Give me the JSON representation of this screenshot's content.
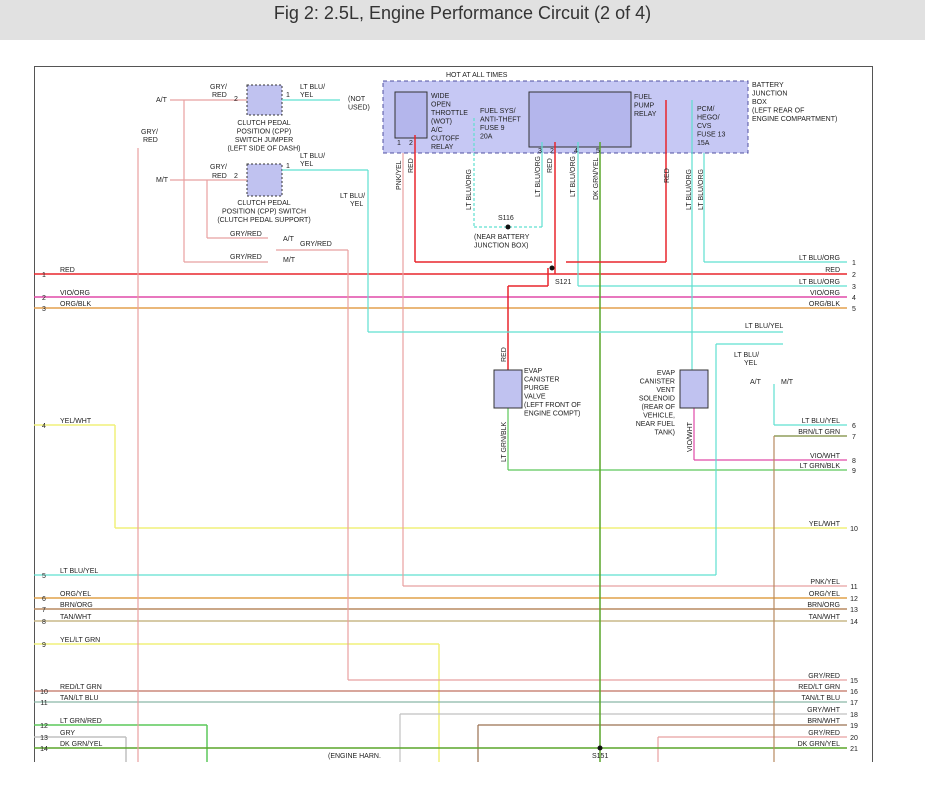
{
  "header": {
    "title": "Fig 2: 2.5L, Engine Performance Circuit (2 of 4)"
  },
  "colors": {
    "red": "#e8262d",
    "violet_orange": "#e04aa8",
    "orange_black": "#e3a04f",
    "lt_blue": "#5fe0d0",
    "yellow": "#f0f07a",
    "orange_yellow": "#e0a24a",
    "brown": "#b88a60",
    "tan": "#c9b889",
    "green": "#5cc85a",
    "gray": "#c0c0c0",
    "pink": "#e8a0a0",
    "dk_green": "#5aa62a",
    "component_fill": "#c0c2f0",
    "component_border": "#5050a0",
    "junction_box_fill": "#c6c8f4"
  },
  "diagram": {
    "hot_at_all_times": "HOT AT ALL TIMES",
    "battery_junction_box": [
      "BATTERY",
      "JUNCTION",
      "BOX",
      "(LEFT REAR OF",
      "ENGINE COMPARTMENT)"
    ],
    "wot_relay": [
      "WIDE",
      "OPEN",
      "THROTTLE",
      "(WOT)",
      "A/C",
      "CUTOFF",
      "RELAY"
    ],
    "fuse9": [
      "FUEL SYS/",
      "ANTI-THEFT",
      "FUSE 9",
      "20A"
    ],
    "fuel_pump_relay": [
      "FUEL",
      "PUMP",
      "RELAY"
    ],
    "fuse13": [
      "PCM/",
      "HEGO/",
      "CVS",
      "FUSE 13",
      "15A"
    ],
    "cpp_jumper": [
      "CLUTCH PEDAL",
      "POSITION (CPP)",
      "SWITCH JUMPER",
      "(LEFT SIDE OF DASH)"
    ],
    "cpp_switch": [
      "CLUTCH PEDAL",
      "POSITION (CPP) SWITCH",
      "(CLUTCH PEDAL SUPPORT)"
    ],
    "not_used": [
      "(NOT",
      "USED)"
    ],
    "evap_purge": [
      "EVAP",
      "CANISTER",
      "PURGE",
      "VALVE",
      "(LEFT FRONT OF",
      "ENGINE COMPT)"
    ],
    "evap_vent": [
      "EVAP",
      "CANISTER",
      "VENT",
      "SOLENOID",
      "(REAR OF",
      "VEHICLE,",
      "NEAR FUEL",
      "TANK)"
    ],
    "s116": "S116",
    "s116_note": [
      "(NEAR BATTERY",
      "JUNCTION BOX)"
    ],
    "s121": "S121",
    "s151": "S151",
    "engine_harn": "(ENGINE HARN.",
    "at": "A/T",
    "mt": "M/T",
    "top_labels": {
      "gry_red": [
        "GRY/",
        "RED"
      ],
      "lt_blu_yel": [
        "LT BLU/",
        "YEL"
      ],
      "pin2": "2",
      "pin1": "1",
      "pin3": "3",
      "pin4": "4",
      "pin5": "5",
      "pin6": "6"
    },
    "vertical_labels": [
      "PNK/YEL",
      "RED",
      "LT BLU/ORG",
      "LT BLU/ORG",
      "RED",
      "LT BLU/ORG",
      "DK GRN/YEL",
      "RED",
      "LT BLU/ORG",
      "LT BLU/ORG",
      "RED",
      "LT GRN/BLK",
      "VIO/WHT"
    ],
    "misc_labels": {
      "gry_red_at": "GRY/RED",
      "gry_red_mt": "GRY/RED",
      "gry_red_mid": "GRY/RED",
      "lt_blu_yel_mid": "LT BLU/YEL",
      "lt_blu_yel_right": [
        "LT BLU/",
        "YEL"
      ],
      "gry_red_left": [
        "GRY/",
        "RED"
      ]
    },
    "left_wires": [
      {
        "num": "1",
        "label": "RED"
      },
      {
        "num": "2",
        "label": "VIO/ORG"
      },
      {
        "num": "3",
        "label": "ORG/BLK"
      },
      {
        "num": "4",
        "label": "YEL/WHT"
      },
      {
        "num": "5",
        "label": "LT BLU/YEL"
      },
      {
        "num": "6",
        "label": "ORG/YEL"
      },
      {
        "num": "7",
        "label": "BRN/ORG"
      },
      {
        "num": "8",
        "label": "TAN/WHT"
      },
      {
        "num": "9",
        "label": "YEL/LT GRN"
      },
      {
        "num": "10",
        "label": "RED/LT GRN"
      },
      {
        "num": "11",
        "label": "TAN/LT BLU"
      },
      {
        "num": "12",
        "label": "LT GRN/RED"
      },
      {
        "num": "13",
        "label": "GRY"
      },
      {
        "num": "14",
        "label": "DK GRN/YEL"
      }
    ],
    "right_wires": [
      {
        "num": "1",
        "label": "LT BLU/ORG"
      },
      {
        "num": "2",
        "label": "RED"
      },
      {
        "num": "3",
        "label": "LT BLU/ORG"
      },
      {
        "num": "4",
        "label": "VIO/ORG"
      },
      {
        "num": "5",
        "label": "ORG/BLK"
      },
      {
        "num": "6",
        "label": "LT BLU/YEL"
      },
      {
        "num": "7",
        "label": "BRN/LT GRN"
      },
      {
        "num": "8",
        "label": "VIO/WHT"
      },
      {
        "num": "9",
        "label": "LT GRN/BLK"
      },
      {
        "num": "10",
        "label": "YEL/WHT"
      },
      {
        "num": "11",
        "label": "PNK/YEL"
      },
      {
        "num": "12",
        "label": "ORG/YEL"
      },
      {
        "num": "13",
        "label": "BRN/ORG"
      },
      {
        "num": "14",
        "label": "TAN/WHT"
      },
      {
        "num": "15",
        "label": "GRY/RED"
      },
      {
        "num": "16",
        "label": "RED/LT GRN"
      },
      {
        "num": "17",
        "label": "TAN/LT BLU"
      },
      {
        "num": "18",
        "label": "GRY/WHT"
      },
      {
        "num": "19",
        "label": "BRN/WHT"
      },
      {
        "num": "20",
        "label": "GRY/RED"
      },
      {
        "num": "21",
        "label": "DK GRN/YEL"
      }
    ]
  }
}
